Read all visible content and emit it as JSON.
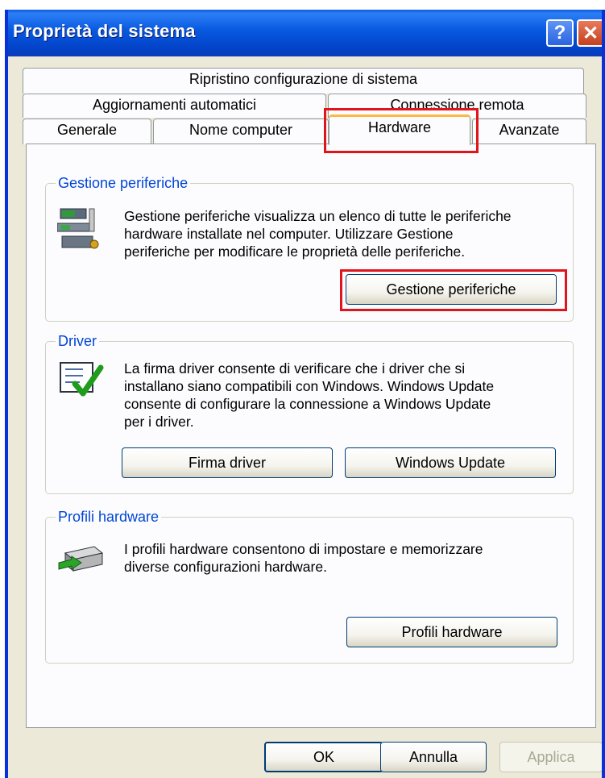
{
  "window": {
    "title": "Proprietà del sistema",
    "help_label": "?",
    "close_label": "✕"
  },
  "tabs": {
    "row1": [
      "Ripristino configurazione di sistema"
    ],
    "row2": [
      "Aggiornamenti automatici",
      "Connessione remota"
    ],
    "row3": [
      "Generale",
      "Nome computer",
      "Hardware",
      "Avanzate"
    ],
    "active": "Hardware"
  },
  "groups": {
    "device_manager": {
      "title": "Gestione periferiche",
      "text_lines": [
        "Gestione periferiche visualizza un elenco di tutte le periferiche",
        "hardware installate nel computer. Utilizzare Gestione",
        "periferiche per modificare le proprietà delle periferiche."
      ],
      "button": "Gestione periferiche",
      "icon": "device-manager-icon"
    },
    "driver": {
      "title": "Driver",
      "text_lines": [
        "La firma driver consente di verificare che i driver che si",
        "installano siano compatibili con Windows. Windows Update",
        "consente di configurare la connessione a Windows Update",
        "per i driver."
      ],
      "button_signing": "Firma driver",
      "button_update": "Windows Update",
      "icon": "driver-signing-icon"
    },
    "hardware_profiles": {
      "title": "Profili hardware",
      "text_lines": [
        "I profili hardware consentono di impostare e memorizzare",
        "diverse configurazioni hardware."
      ],
      "button": "Profili hardware",
      "icon": "hardware-profiles-icon"
    }
  },
  "footer": {
    "ok": "OK",
    "cancel": "Annulla",
    "apply": "Applica"
  },
  "colors": {
    "titlebar": "#0a5be6",
    "group_title": "#0046d5",
    "highlight": "#e0141b",
    "active_tab_accent": "#f9b944"
  }
}
